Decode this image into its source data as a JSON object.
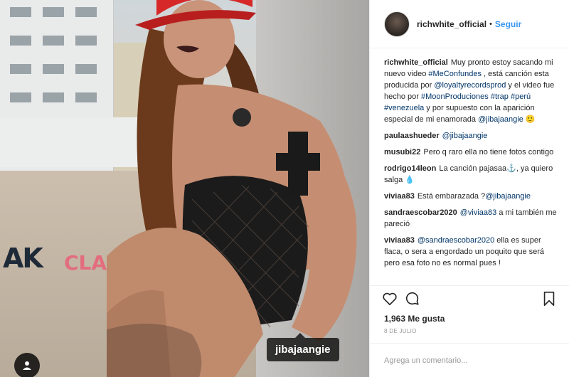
{
  "post": {
    "tagged_user": "jibajaangie"
  },
  "header": {
    "username": "richwhite_official",
    "separator": "•",
    "follow_label": "Seguir"
  },
  "comments": [
    {
      "user": "richwhite_official",
      "parts": [
        {
          "t": "Muy pronto estoy sacando mi nuevo video "
        },
        {
          "t": "#MeConfundes",
          "link": true
        },
        {
          "t": " , está canción esta producida por "
        },
        {
          "t": "@loyaltyrecordsprod",
          "link": true
        },
        {
          "t": " y el video fue hecho por "
        },
        {
          "t": "#MoonProduciones",
          "link": true
        },
        {
          "t": " "
        },
        {
          "t": "#trap",
          "link": true
        },
        {
          "t": " "
        },
        {
          "t": "#perú",
          "link": true
        },
        {
          "t": " "
        },
        {
          "t": "#venezuela",
          "link": true
        },
        {
          "t": " y por supuesto con la aparición especial de mi enamorada "
        },
        {
          "t": "@jibajaangie",
          "link": true
        },
        {
          "t": " 🙂"
        }
      ]
    },
    {
      "user": "paulaashueder",
      "parts": [
        {
          "t": "@jibajaangie",
          "link": true
        }
      ]
    },
    {
      "user": "musubi22",
      "parts": [
        {
          "t": "Pero q raro ella no tiene fotos contigo"
        }
      ]
    },
    {
      "user": "rodrigo14leon",
      "parts": [
        {
          "t": "La canción pajasaa⚓, ya quiero salga 💧"
        }
      ]
    },
    {
      "user": "viviaa83",
      "parts": [
        {
          "t": "Está embarazada ?"
        },
        {
          "t": "@jibajaangie",
          "link": true
        }
      ]
    },
    {
      "user": "sandraescobar2020",
      "parts": [
        {
          "t": "@viviaa83",
          "link": true
        },
        {
          "t": " a mi también me pareció"
        }
      ]
    },
    {
      "user": "viviaa83",
      "parts": [
        {
          "t": "@sandraescobar2020",
          "link": true
        },
        {
          "t": " ella es super flaca, o sera a engordado un poquito que será pero esa foto no es normal pues !"
        }
      ]
    }
  ],
  "actions": {
    "icons": [
      "heart-icon",
      "comment-icon",
      "bookmark-icon"
    ]
  },
  "likes": "1,963 Me gusta",
  "date": "8 DE JULIO",
  "add_comment": {
    "placeholder": "Agrega un comentario..."
  },
  "colors": {
    "link": "#003569",
    "follow": "#3897f0",
    "hat": "#d62828"
  }
}
